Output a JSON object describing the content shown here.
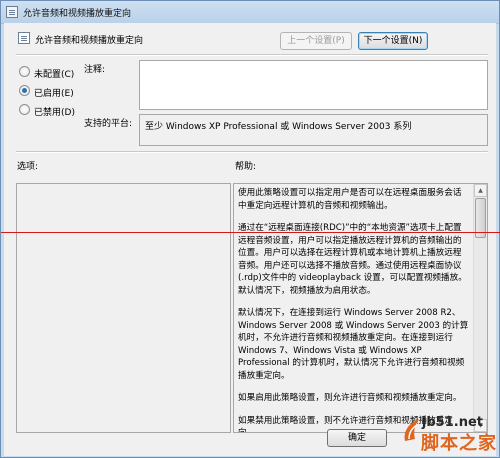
{
  "window": {
    "title": "允许音频和视频播放重定向",
    "minimize_glyph": "—",
    "maximize_glyph": "□",
    "close_glyph": "✕"
  },
  "header": {
    "policy_title": "允许音频和视频播放重定向",
    "prev_label": "上一个设置(P)",
    "next_label": "下一个设置(N)"
  },
  "options": {
    "not_configured": "未配置(C)",
    "enabled": "已启用(E)",
    "disabled": "已禁用(D)",
    "selected": "enabled"
  },
  "comment": {
    "label": "注释:",
    "value": ""
  },
  "platform": {
    "label": "支持的平台:",
    "value": "至少 Windows XP Professional 或 Windows Server 2003 系列"
  },
  "options_section": {
    "label": "选项:"
  },
  "help_section": {
    "label": "帮助:",
    "paragraphs": [
      "使用此策略设置可以指定用户是否可以在远程桌面服务会话中重定向远程计算机的音频和视频输出。",
      "通过在“远程桌面连接(RDC)”中的“本地资源”选项卡上配置远程音频设置，用户可以指定播放远程计算机的音频输出的位置。用户可以选择在远程计算机或本地计算机上播放远程音频。用户还可以选择不播放音频。通过使用远程桌面协议(.rdp)文件中的 videoplayback 设置，可以配置视频播放。默认情况下，视频播放为启用状态。",
      "默认情况下，在连接到运行 Windows Server 2008 R2、Windows Server 2008 或 Windows Server 2003 的计算机时，不允许进行音频和视频播放重定向。在连接到运行 Windows 7、Windows Vista 或 Windows XP Professional 的计算机时，默认情况下允许进行音频和视频播放重定向。",
      "如果启用此策略设置，则允许进行音频和视频播放重定向。",
      "如果禁用此策略设置，则不允许进行音频和视频播放重定向。"
    ]
  },
  "footer": {
    "ok_label": "确定"
  },
  "watermark": {
    "site": "jb51.net",
    "name": "脚本之家"
  },
  "colors": {
    "accent": "#2b6fb5",
    "annotation_line": "#d21a1a",
    "watermark_orange": "#e0651e"
  }
}
